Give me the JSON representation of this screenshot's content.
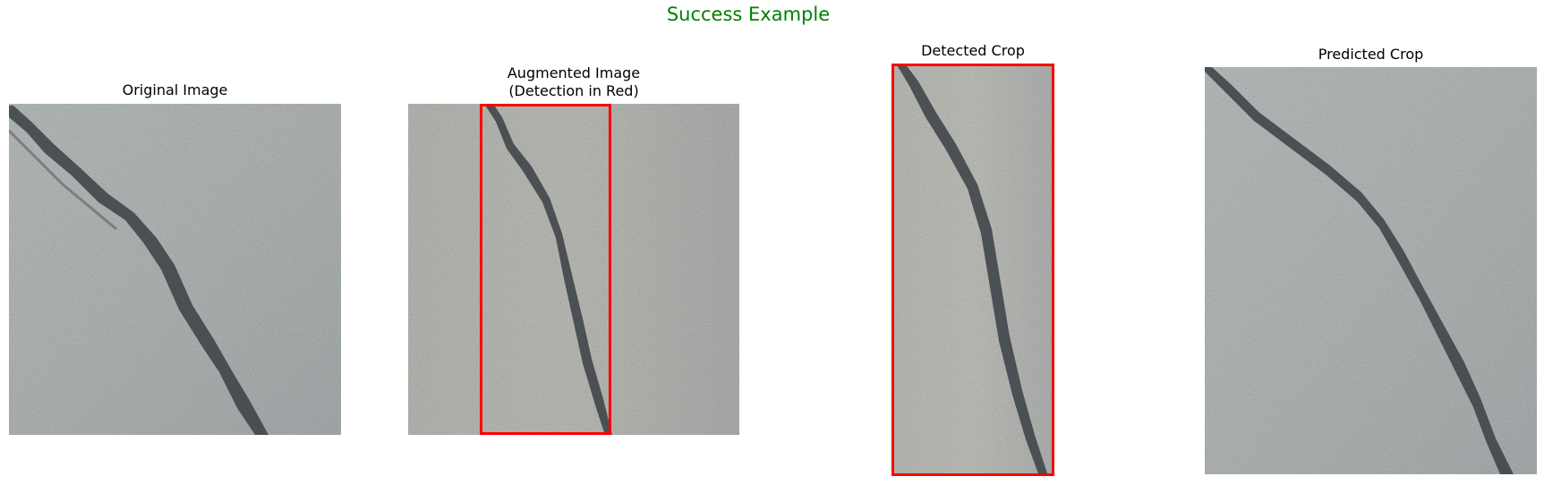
{
  "figure": {
    "suptitle": "Success Example",
    "suptitle_color": "#008000",
    "detection_color": "#ff0000"
  },
  "panels": [
    {
      "title": "Original Image"
    },
    {
      "title_line1": "Augmented Image",
      "title_line2": "(Detection in Red)"
    },
    {
      "title": "Detected Crop"
    },
    {
      "title": "Predicted Crop"
    }
  ]
}
